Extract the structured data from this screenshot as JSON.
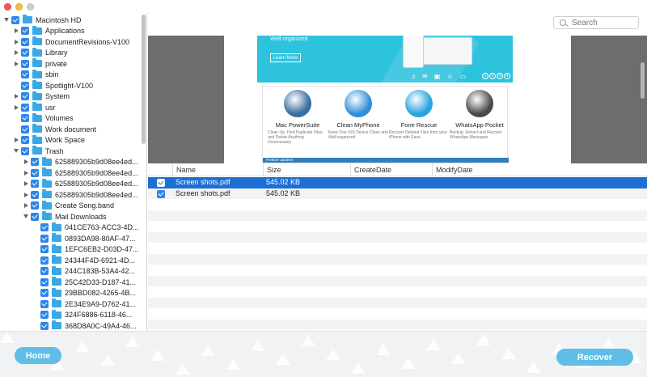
{
  "search": {
    "placeholder": "Search"
  },
  "tree": [
    {
      "label": "Macintosh HD",
      "level": 0,
      "expander": "open"
    },
    {
      "label": "Applications",
      "level": 1,
      "expander": "closed"
    },
    {
      "label": "DocumentRevisions-V100",
      "level": 1,
      "expander": "closed"
    },
    {
      "label": "Library",
      "level": 1,
      "expander": "closed"
    },
    {
      "label": "private",
      "level": 1,
      "expander": "closed"
    },
    {
      "label": "sbin",
      "level": 1,
      "expander": "none"
    },
    {
      "label": "Spotlight-V100",
      "level": 1,
      "expander": "none"
    },
    {
      "label": "System",
      "level": 1,
      "expander": "closed"
    },
    {
      "label": "usr",
      "level": 1,
      "expander": "closed"
    },
    {
      "label": "Volumes",
      "level": 1,
      "expander": "none"
    },
    {
      "label": "Work document",
      "level": 1,
      "expander": "none"
    },
    {
      "label": "Work Space",
      "level": 1,
      "expander": "closed"
    },
    {
      "label": "Trash",
      "level": 1,
      "expander": "open"
    },
    {
      "label": "625889305b9d08ee4ed...",
      "level": 2,
      "expander": "closed"
    },
    {
      "label": "625889305b9d08ee4ed...",
      "level": 2,
      "expander": "closed"
    },
    {
      "label": "625889305b9d08ee4ed...",
      "level": 2,
      "expander": "closed"
    },
    {
      "label": "625889305b9d08ee4ed...",
      "level": 2,
      "expander": "closed"
    },
    {
      "label": "Create Song.band",
      "level": 2,
      "expander": "closed"
    },
    {
      "label": "Mail Downloads",
      "level": 2,
      "expander": "open"
    },
    {
      "label": "041CE763-ACC3-4D...",
      "level": 3,
      "expander": "none"
    },
    {
      "label": "0893DA98-80AF-47...",
      "level": 3,
      "expander": "none"
    },
    {
      "label": "1EFC6EB2-D03D-47...",
      "level": 3,
      "expander": "none"
    },
    {
      "label": "24344F4D-6921-4D...",
      "level": 3,
      "expander": "none"
    },
    {
      "label": "244C183B-53A4-42...",
      "level": 3,
      "expander": "none"
    },
    {
      "label": "25C42D33-D187-41...",
      "level": 3,
      "expander": "none"
    },
    {
      "label": "29BBD082-4265-4B...",
      "level": 3,
      "expander": "none"
    },
    {
      "label": "2E34E9A9-D762-41...",
      "level": 3,
      "expander": "none"
    },
    {
      "label": "324F6886-6118-46...",
      "level": 3,
      "expander": "none"
    },
    {
      "label": "368D8A0C-49A4-46...",
      "level": 3,
      "expander": "none"
    }
  ],
  "preview": {
    "banner_text": "Well-organized",
    "learn_more": "Learn More",
    "dots": [
      "1",
      "2",
      "3",
      "4"
    ],
    "products": [
      {
        "name": "Mac PowerSuite",
        "desc": "Clean Up, Find Duplicate Files and Delete Anything Unnecessary",
        "color": "#3a6e9e",
        "icon": "wrench-icon"
      },
      {
        "name": "Clean MyPhone",
        "desc": "Keep Your iOS Device Clean and Well-organized",
        "color": "#2f8fd8",
        "icon": "broom-icon"
      },
      {
        "name": "Fone Rescue",
        "desc": "Recover Deleted Files from your iPhone with Ease.",
        "color": "#27a3e0",
        "icon": "phone-rescue-icon"
      },
      {
        "name": "WhatsApp Pocket",
        "desc": "Backup, Extract and Recover WhatsApp Messages",
        "color": "#4a4a4a",
        "icon": "whatsapp-pocket-icon"
      }
    ],
    "footer_bar": "Freebie Updates"
  },
  "table": {
    "columns": [
      "Name",
      "Size",
      "CreateDate",
      "ModifyDate"
    ],
    "rows": [
      {
        "name": "Screen shots.pdf",
        "size": "545.02 KB",
        "create": "",
        "modify": "",
        "selected": true
      },
      {
        "name": "Screen shots.pdf",
        "size": "545.02 KB",
        "create": "",
        "modify": "",
        "selected": false
      }
    ]
  },
  "buttons": {
    "home": "Home",
    "recover": "Recover"
  },
  "colors": {
    "accent": "#5fbde8",
    "selection": "#1d6fd4",
    "checkbox": "#2d86ea",
    "folder": "#3aa8e6",
    "banner": "#2ec3dd"
  }
}
